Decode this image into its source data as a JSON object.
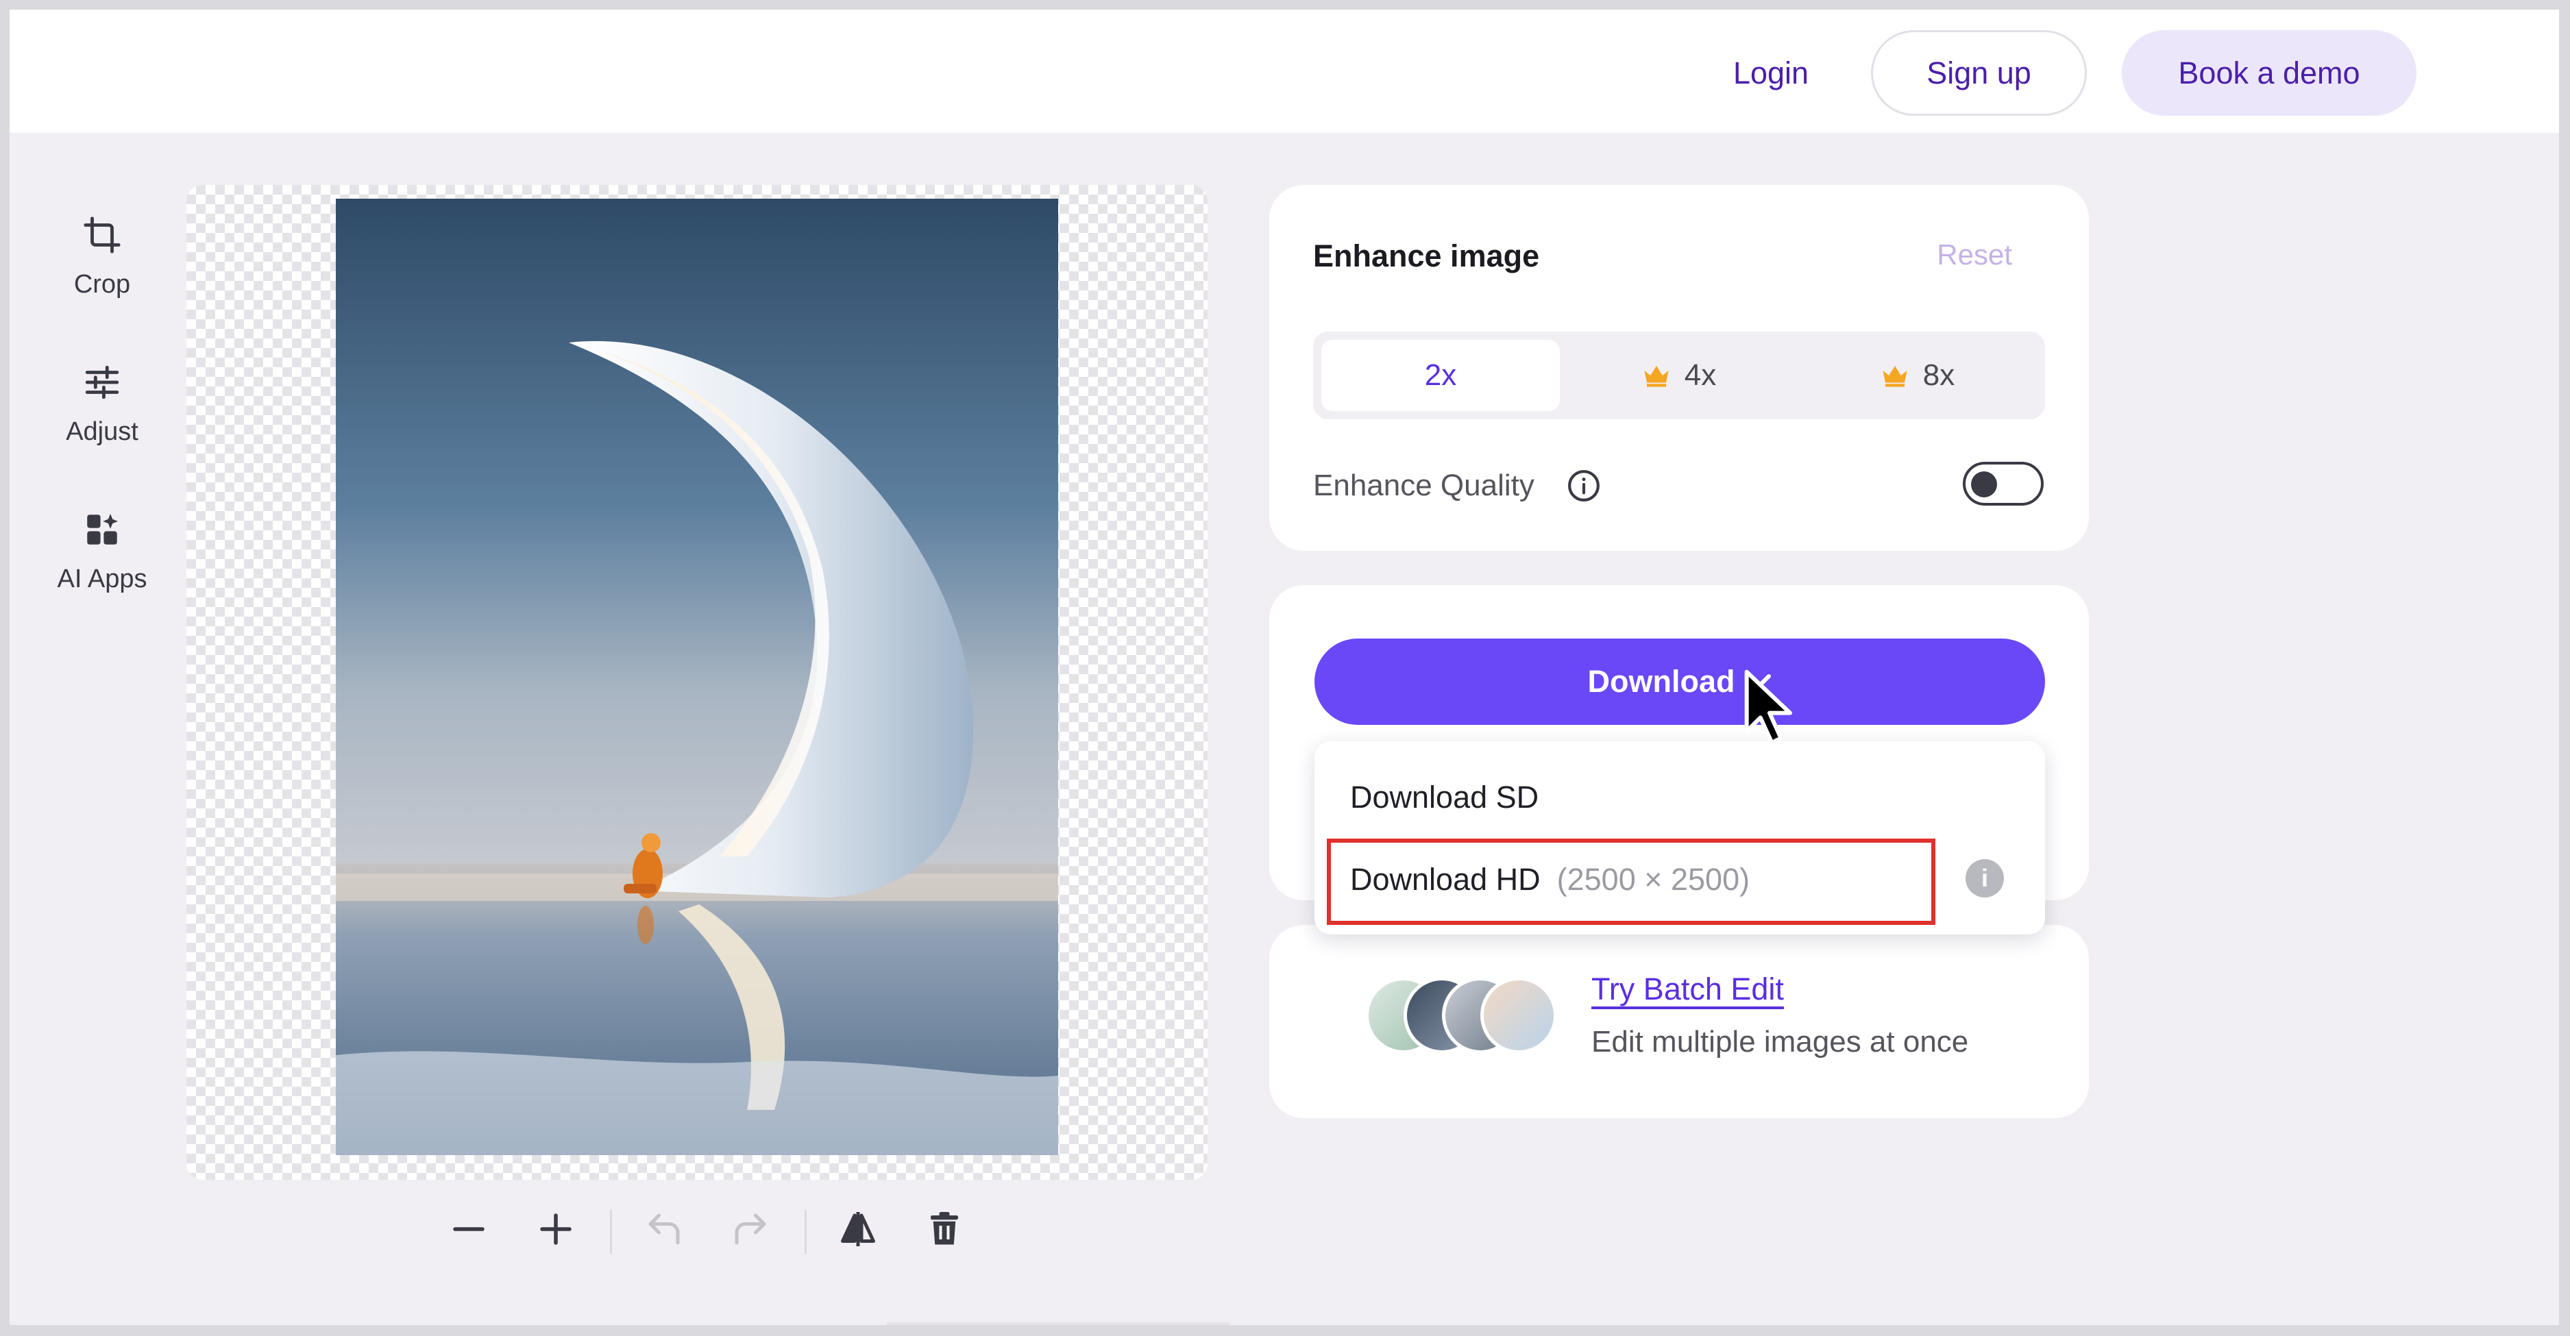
{
  "header": {
    "login": "Login",
    "signup": "Sign up",
    "book_demo": "Book a demo"
  },
  "tools": [
    {
      "label": "Crop",
      "icon": "crop-icon"
    },
    {
      "label": "Adjust",
      "icon": "sliders-icon"
    },
    {
      "label": "AI Apps",
      "icon": "apps-icon"
    }
  ],
  "enhance": {
    "title": "Enhance image",
    "reset": "Reset",
    "scales": [
      {
        "label": "2x",
        "premium": false,
        "active": true
      },
      {
        "label": "4x",
        "premium": true,
        "active": false
      },
      {
        "label": "8x",
        "premium": true,
        "active": false
      }
    ],
    "quality_label": "Enhance Quality",
    "quality_enabled": false
  },
  "download": {
    "button_label": "Download",
    "menu": {
      "sd": "Download SD",
      "hd": "Download HD",
      "hd_size": "(2500 × 2500)"
    }
  },
  "batch": {
    "link": "Try Batch Edit",
    "subtitle": "Edit multiple images at once"
  },
  "colors": {
    "accent": "#6a47f7",
    "nav_text": "#4b1fa8",
    "highlight": "#e0312c",
    "premium": "#f5a623"
  }
}
